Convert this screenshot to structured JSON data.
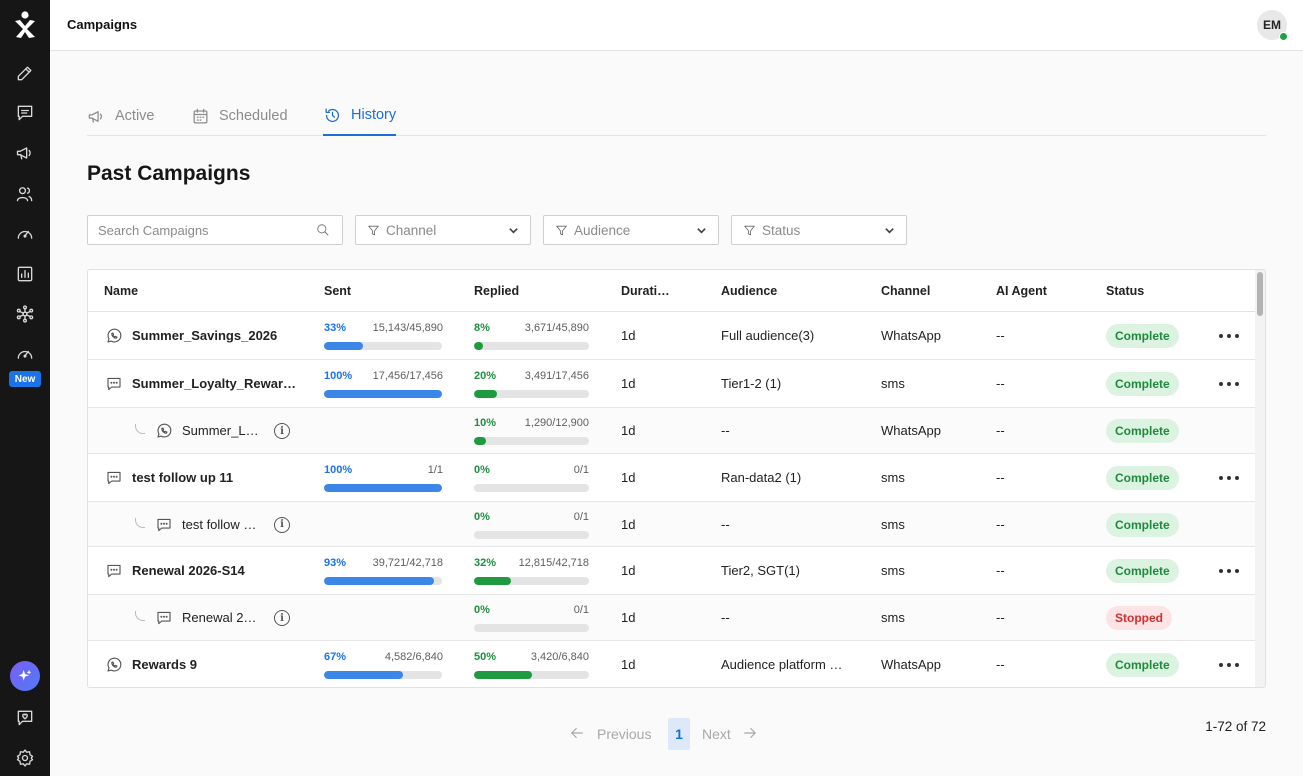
{
  "app": {
    "title": "Campaigns",
    "avatar_initials": "EM",
    "new_badge": "New"
  },
  "tabs": [
    {
      "label": "Active",
      "icon": "megaphone-icon"
    },
    {
      "label": "Scheduled",
      "icon": "calendar-icon"
    },
    {
      "label": "History",
      "icon": "history-icon",
      "active": true
    }
  ],
  "page_title": "Past Campaigns",
  "search": {
    "placeholder": "Search Campaigns"
  },
  "filters": {
    "channel": "Channel",
    "audience": "Audience",
    "status": "Status"
  },
  "table": {
    "headers": {
      "name": "Name",
      "sent": "Sent",
      "replied": "Replied",
      "duration": "Durati…",
      "audience": "Audience",
      "channel": "Channel",
      "ai_agent": "AI Agent",
      "status": "Status"
    },
    "rows": [
      {
        "type": "main",
        "icon": "whatsapp-icon",
        "name": "Summer_Savings_2026",
        "sent_pct": "33%",
        "sent_count": "15,143/45,890",
        "sent_frac": 0.33,
        "replied_pct": "8%",
        "replied_count": "3,671/45,890",
        "replied_frac": 0.08,
        "duration": "1d",
        "audience": "Full audience(3)",
        "channel": "WhatsApp",
        "ai_agent": "--",
        "status": "Complete"
      },
      {
        "type": "main",
        "icon": "sms-icon",
        "name": "Summer_Loyalty_Rewar…",
        "sent_pct": "100%",
        "sent_count": "17,456/17,456",
        "sent_frac": 1.0,
        "replied_pct": "20%",
        "replied_count": "3,491/17,456",
        "replied_frac": 0.2,
        "duration": "1d",
        "audience": "Tier1-2 (1)",
        "channel": "sms",
        "ai_agent": "--",
        "status": "Complete"
      },
      {
        "type": "child",
        "icon": "whatsapp-icon",
        "name": "Summer_L…",
        "replied_pct": "10%",
        "replied_count": "1,290/12,900",
        "replied_frac": 0.1,
        "duration": "1d",
        "audience": "--",
        "channel": "WhatsApp",
        "ai_agent": "--",
        "status": "Complete"
      },
      {
        "type": "main",
        "icon": "sms-icon",
        "name": "test follow up 11",
        "sent_pct": "100%",
        "sent_count": "1/1",
        "sent_frac": 1.0,
        "replied_pct": "0%",
        "replied_count": "0/1",
        "replied_frac": 0,
        "duration": "1d",
        "audience": "Ran-data2 (1)",
        "channel": "sms",
        "ai_agent": "--",
        "status": "Complete"
      },
      {
        "type": "child",
        "icon": "sms-icon",
        "name": "test follow …",
        "replied_pct": "0%",
        "replied_count": "0/1",
        "replied_frac": 0,
        "duration": "1d",
        "audience": "--",
        "channel": "sms",
        "ai_agent": "--",
        "status": "Complete"
      },
      {
        "type": "main",
        "icon": "sms-icon",
        "name": "Renewal 2026-S14",
        "sent_pct": "93%",
        "sent_count": "39,721/42,718",
        "sent_frac": 0.93,
        "replied_pct": "32%",
        "replied_count": "12,815/42,718",
        "replied_frac": 0.32,
        "duration": "1d",
        "audience": "Tier2, SGT(1)",
        "channel": "sms",
        "ai_agent": "--",
        "status": "Complete"
      },
      {
        "type": "child",
        "icon": "sms-icon",
        "name": "Renewal 2…",
        "replied_pct": "0%",
        "replied_count": "0/1",
        "replied_frac": 0,
        "duration": "1d",
        "audience": "--",
        "channel": "sms",
        "ai_agent": "--",
        "status": "Stopped"
      },
      {
        "type": "main",
        "icon": "whatsapp-icon",
        "name": "Rewards 9",
        "sent_pct": "67%",
        "sent_count": "4,582/6,840",
        "sent_frac": 0.67,
        "replied_pct": "50%",
        "replied_count": "3,420/6,840",
        "replied_frac": 0.5,
        "duration": "1d",
        "audience": "Audience platform …",
        "channel": "WhatsApp",
        "ai_agent": "--",
        "status": "Complete"
      }
    ]
  },
  "pagination": {
    "previous": "Previous",
    "next": "Next",
    "current_page": "1",
    "range": "1-72 of 72"
  }
}
